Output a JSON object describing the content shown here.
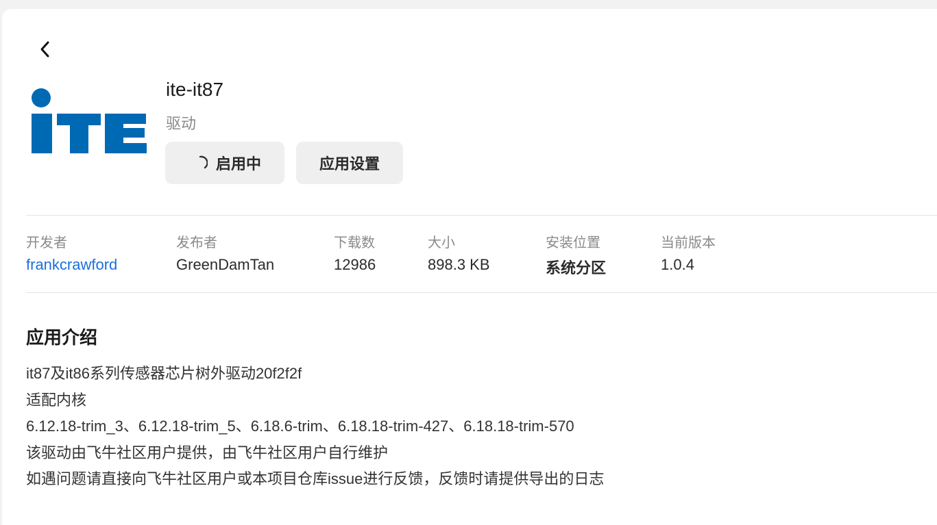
{
  "app": {
    "title": "ite-it87",
    "category": "驱动",
    "logo_text": "iTE",
    "logo_color": "#0069b4"
  },
  "actions": {
    "enable_label": "启用中",
    "settings_label": "应用设置"
  },
  "meta": [
    {
      "label": "开发者",
      "value": "frankcrawford"
    },
    {
      "label": "发布者",
      "value": "GreenDamTan"
    },
    {
      "label": "下载数",
      "value": "12986"
    },
    {
      "label": "大小",
      "value": "898.3 KB"
    },
    {
      "label": "安装位置",
      "value": "系统分区"
    },
    {
      "label": "当前版本",
      "value": "1.0.4"
    }
  ],
  "intro": {
    "title": "应用介绍",
    "lines": [
      "it87及it86系列传感器芯片树外驱动20f2f2f",
      "适配内核",
      "6.12.18-trim_3、6.12.18-trim_5、6.18.6-trim、6.18.18-trim-427、6.18.18-trim-570",
      "该驱动由飞牛社区用户提供，由飞牛社区用户自行维护",
      "如遇问题请直接向飞牛社区用户或本项目仓库issue进行反馈，反馈时请提供导出的日志"
    ]
  },
  "colors": {
    "link": "#1a6fe0",
    "button_bg": "#efefef",
    "muted_text": "#8a8a8a"
  },
  "icons": {
    "back": "chevron-left-icon",
    "loading": "loading-spinner-icon"
  }
}
